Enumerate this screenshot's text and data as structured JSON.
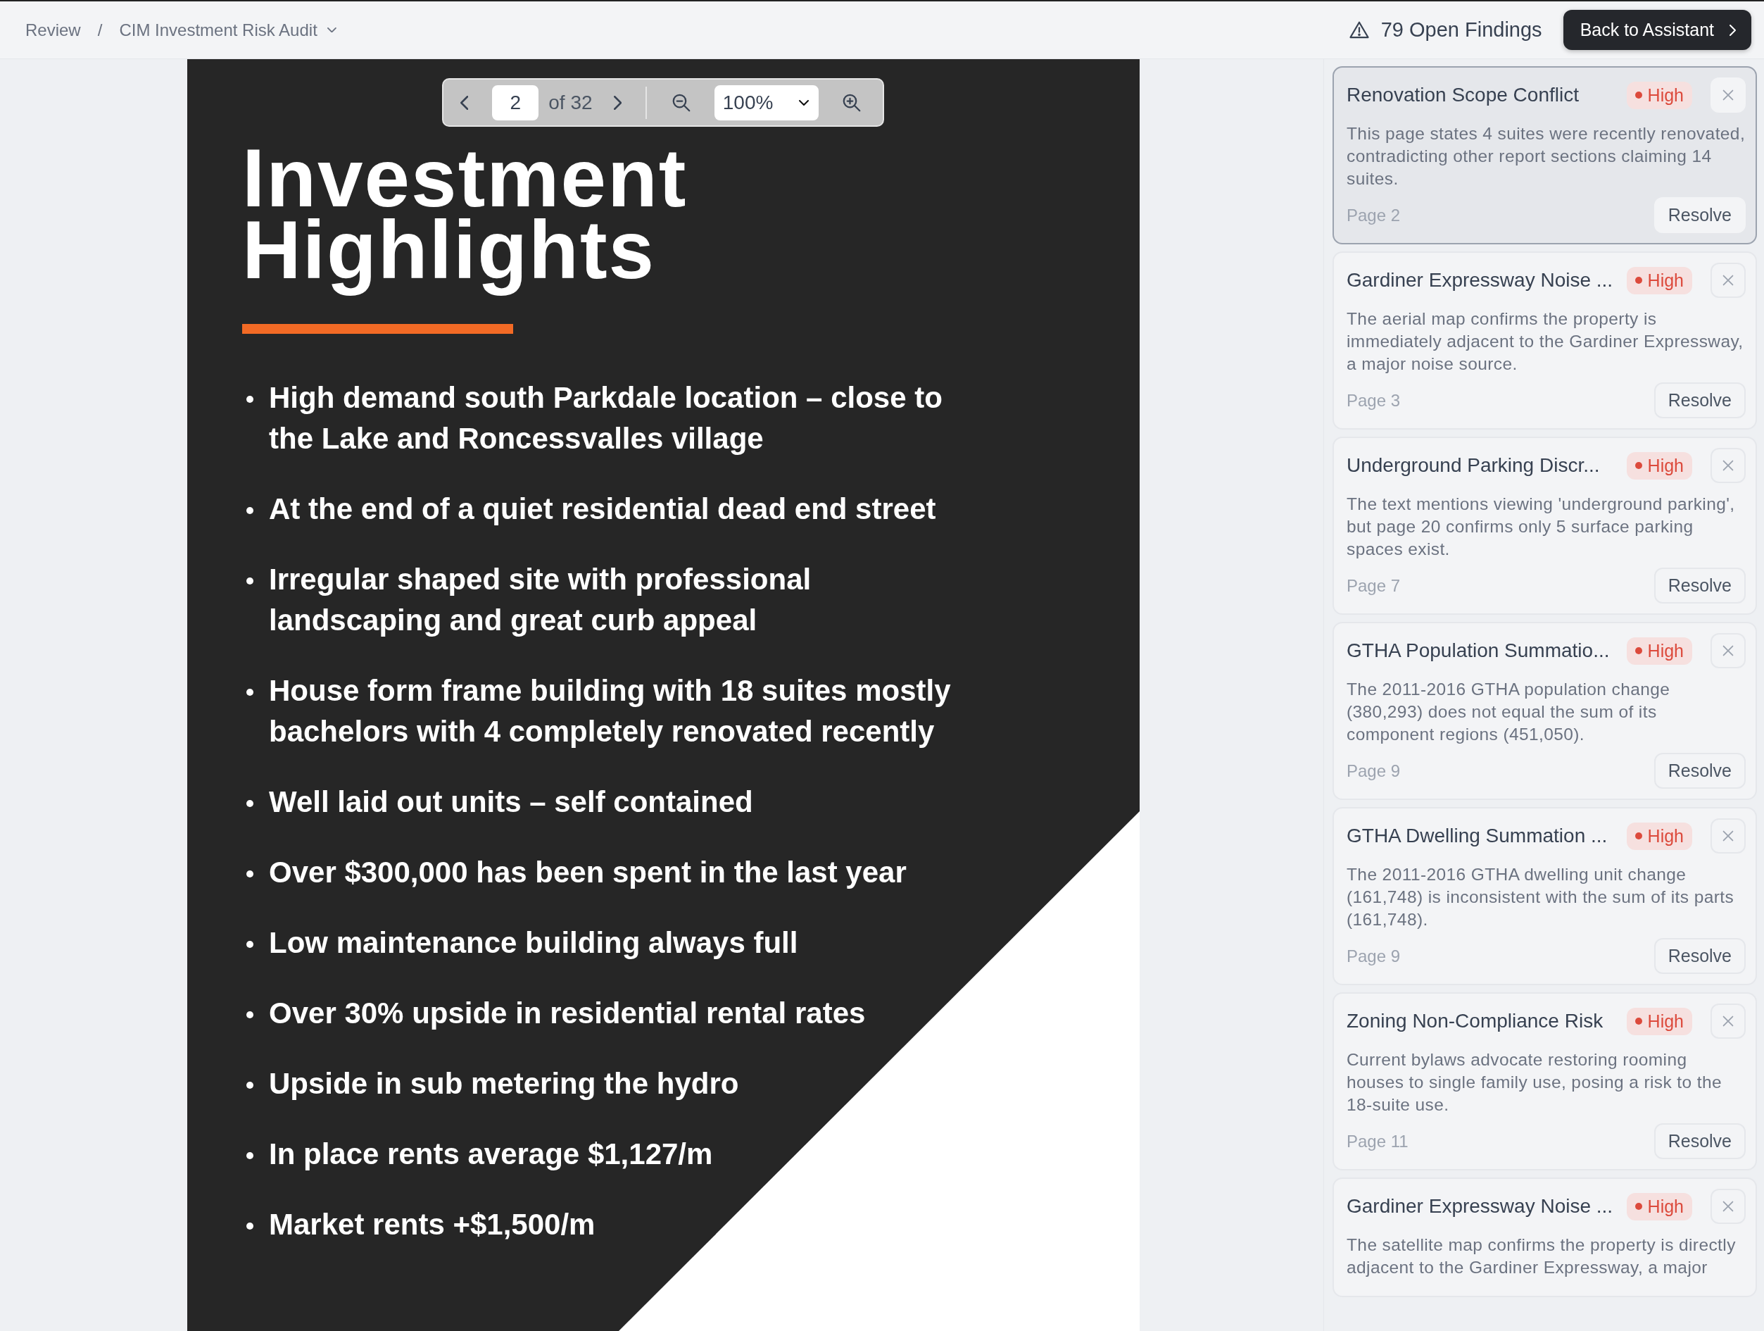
{
  "breadcrumb": {
    "root": "Review",
    "separator": "/",
    "current": "CIM Investment Risk Audit"
  },
  "findings_count": "79 Open Findings",
  "back_button": "Back to Assistant",
  "viewer": {
    "page_input": "2",
    "page_total": "of 32",
    "zoom": "100%"
  },
  "document": {
    "title": "Investment Highlights",
    "bullets": [
      "High demand south Parkdale location – close to the Lake and Roncessvalles village",
      "At the end of a quiet residential dead end street",
      "Irregular shaped site with professional landscaping and great curb appeal",
      "House form frame building with 18 suites mostly bachelors with 4 completely renovated recently",
      "Well laid out units – self contained",
      "Over $300,000 has been spent in the last year",
      "Low maintenance building always full",
      "Over 30% upside in residential rental rates",
      "Upside in sub metering the hydro",
      "In place rents average $1,127/m",
      "Market rents +$1,500/m"
    ]
  },
  "findings": [
    {
      "title": "Renovation Scope Conflict",
      "severity": "High",
      "description": "This page states 4 suites were recently renovated, contradicting other report sections claiming 14 suites.",
      "page": "Page 2",
      "action": "Resolve",
      "selected": true
    },
    {
      "title": "Gardiner Expressway Noise ...",
      "severity": "High",
      "description": "The aerial map confirms the property is immediately adjacent to the Gardiner Expressway, a major noise source.",
      "page": "Page 3",
      "action": "Resolve",
      "selected": false
    },
    {
      "title": "Underground Parking Discr...",
      "severity": "High",
      "description": "The text mentions viewing 'underground parking', but page 20 confirms only 5 surface parking spaces exist.",
      "page": "Page 7",
      "action": "Resolve",
      "selected": false
    },
    {
      "title": "GTHA Population Summatio...",
      "severity": "High",
      "description": "The 2011-2016 GTHA population change (380,293) does not equal the sum of its component regions (451,050).",
      "page": "Page 9",
      "action": "Resolve",
      "selected": false
    },
    {
      "title": "GTHA Dwelling Summation ...",
      "severity": "High",
      "description": "The 2011-2016 GTHA dwelling unit change (161,748) is inconsistent with the sum of its parts (161,748).",
      "page": "Page 9",
      "action": "Resolve",
      "selected": false
    },
    {
      "title": "Zoning Non-Compliance Risk",
      "severity": "High",
      "description": "Current bylaws advocate restoring rooming houses to single family use, posing a risk to the 18-suite use.",
      "page": "Page 11",
      "action": "Resolve",
      "selected": false
    },
    {
      "title": "Gardiner Expressway Noise ...",
      "severity": "High",
      "description": "The satellite map confirms the property is directly adjacent to the Gardiner Expressway, a major",
      "selected": false
    }
  ]
}
